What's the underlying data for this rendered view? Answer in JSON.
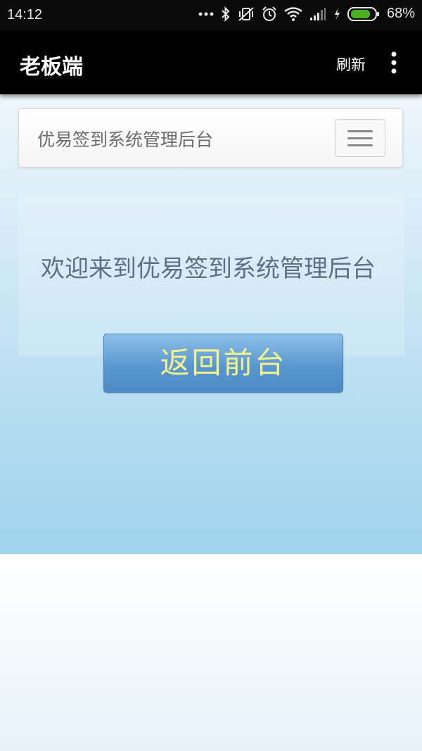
{
  "status_bar": {
    "time": "14:12",
    "battery_percent": "68%",
    "icons": [
      "more-dots-icon",
      "bluetooth-icon",
      "vibrate-off-icon",
      "alarm-icon",
      "wifi-icon",
      "signal-icon",
      "charging-icon",
      "battery-icon"
    ],
    "battery_color": "#4caf1e"
  },
  "action_bar": {
    "title": "老板端",
    "refresh_label": "刷新",
    "overflow_icon": "more-vert-icon"
  },
  "navbar": {
    "brand": "优易签到系统管理后台",
    "toggle_icon": "hamburger-menu-icon"
  },
  "hero": {
    "welcome_text": "欢迎来到优易签到系统管理后台"
  },
  "back_button": {
    "label": "返回前台",
    "text_color": "#f4f28a"
  }
}
